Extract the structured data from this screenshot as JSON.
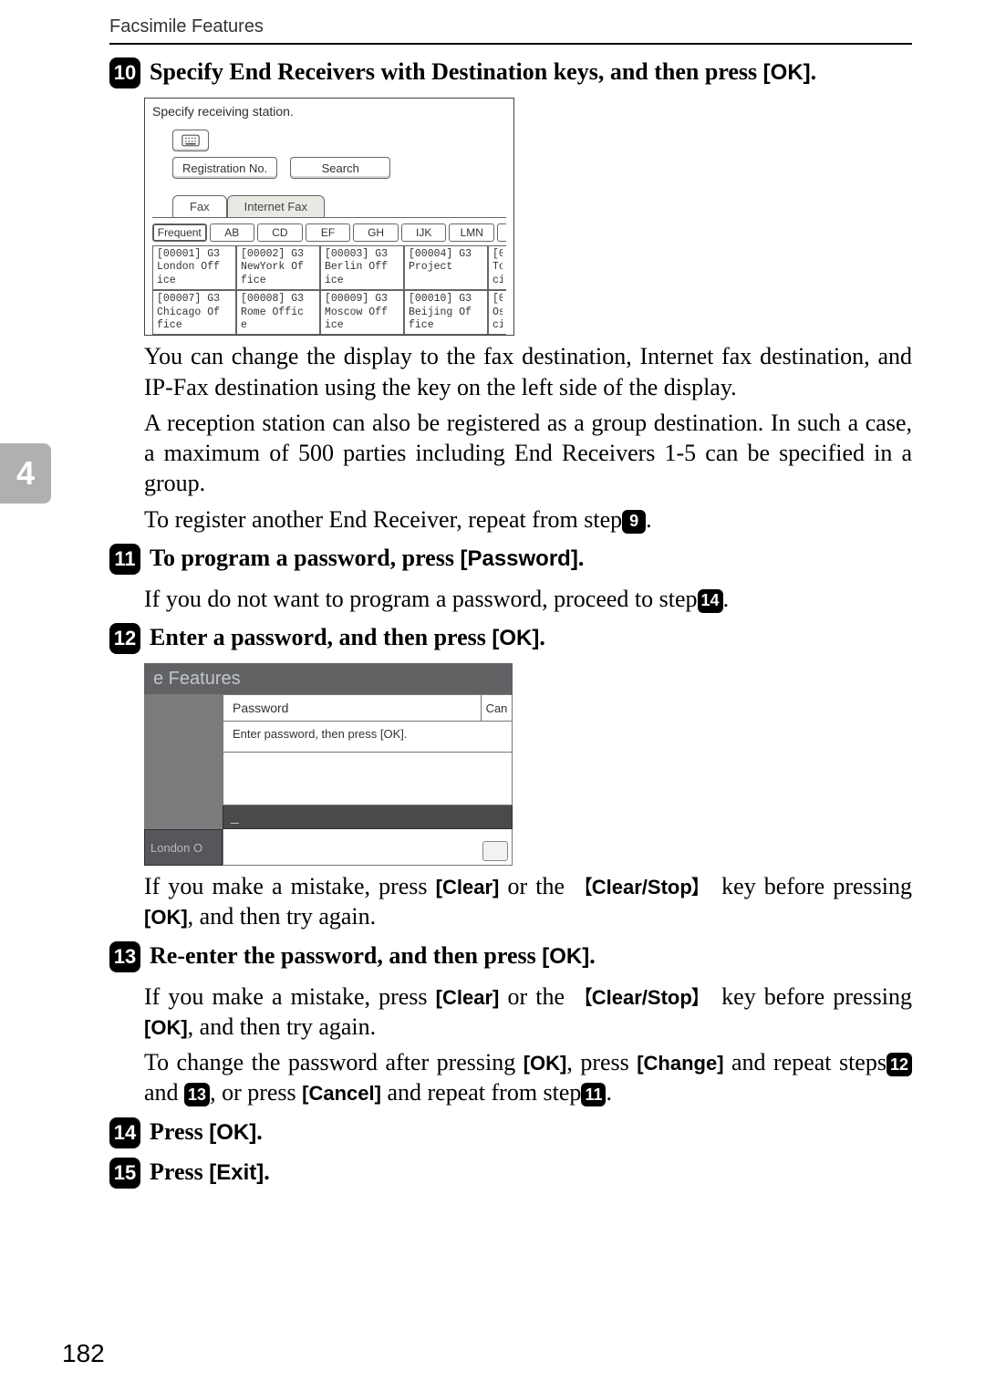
{
  "page": {
    "running_head": "Facsimile Features",
    "chapter_tab": "4",
    "page_number": "182"
  },
  "step10": {
    "badge": "10",
    "title_pre": "Specify End Receivers with Destination keys, and then press ",
    "title_key": "[OK]",
    "title_post": "."
  },
  "scr1": {
    "title": "Specify receiving station.",
    "reg_no": "Registration No.",
    "search": "Search",
    "fax_tab": "Fax",
    "inet_tab": "Internet Fax",
    "az": [
      "Frequent",
      "AB",
      "CD",
      "EF",
      "GH",
      "IJK",
      "LMN"
    ],
    "dest_row1": [
      {
        "id": "[00001] G3",
        "l1": "London Off",
        "l2": "ice"
      },
      {
        "id": "[00002] G3",
        "l1": "NewYork Of",
        "l2": "fice"
      },
      {
        "id": "[00003] G3",
        "l1": "Berlin Off",
        "l2": "ice"
      },
      {
        "id": "[00004] G3",
        "l1": "Project",
        "l2": ""
      }
    ],
    "dest_row1_cut": {
      "l1": "[0",
      "l2": "To",
      "l3": "ci"
    },
    "dest_row2": [
      {
        "id": "[00007] G3",
        "l1": "Chicago Of",
        "l2": "fice"
      },
      {
        "id": "[00008] G3",
        "l1": "Rome Offic",
        "l2": "e"
      },
      {
        "id": "[00009] G3",
        "l1": "Moscow Off",
        "l2": "ice"
      },
      {
        "id": "[00010] G3",
        "l1": "Beijing Of",
        "l2": "fice"
      }
    ],
    "dest_row2_cut": {
      "l1": "[0",
      "l2": "Os",
      "l3": "ci"
    }
  },
  "after10": {
    "p1": "You can change the display to the fax destination, Internet fax destination, and IP-Fax destination using the key on the left side of the display.",
    "p2": "A reception station can also be registered as a group destination. In such a case, a maximum of 500 parties including End Receivers 1-5 can be specified in a group.",
    "p3_pre": "To register another End Receiver, repeat from step",
    "p3_badge": "9",
    "p3_post": "."
  },
  "step11": {
    "badge": "11",
    "title": "To program a password, press ",
    "key": "[Password]",
    "after": ".",
    "body_pre": "If you do not want to program a password, proceed to step",
    "body_badge": "14",
    "body_post": "."
  },
  "step12": {
    "badge": "12",
    "title": "Enter a password, and then press ",
    "key": "[OK]",
    "after": "."
  },
  "scr2": {
    "topbar": "e Features",
    "password_label": "Password",
    "cancel_fragment": "Can",
    "instruction": "Enter password, then press [OK].",
    "cursor": "_",
    "list_item": "London O"
  },
  "after12": {
    "p_pre": "If you make a mistake, press ",
    "clear": "[Clear]",
    "or": " or the ",
    "hw": "Clear/Stop",
    "mid": " key before pressing ",
    "ok": "[OK]",
    "post": ", and then try again."
  },
  "step13": {
    "badge": "13",
    "title": "Re-enter the password, and then press ",
    "key": "[OK]",
    "after": ".",
    "p1_pre": "If you make a mistake, press ",
    "p1_clear": "[Clear]",
    "p1_or": " or the ",
    "p1_hw": "Clear/Stop",
    "p1_mid": " key before pressing ",
    "p1_ok": "[OK]",
    "p1_post": ", and then try again.",
    "p2_pre": "To change the password after pressing ",
    "p2_ok1": "[OK]",
    "p2_mid1": ", press ",
    "p2_change": "[Change]",
    "p2_mid2": " and repeat steps",
    "p2_b12": "12",
    "p2_and": " and ",
    "p2_b13": "13",
    "p2_mid3": ", or press ",
    "p2_cancel": "[Cancel]",
    "p2_mid4": " and repeat from step",
    "p2_b11": "11",
    "p2_post": "."
  },
  "step14": {
    "badge": "14",
    "title": "Press ",
    "key": "[OK]",
    "after": "."
  },
  "step15": {
    "badge": "15",
    "title": "Press ",
    "key": "[Exit]",
    "after": "."
  }
}
